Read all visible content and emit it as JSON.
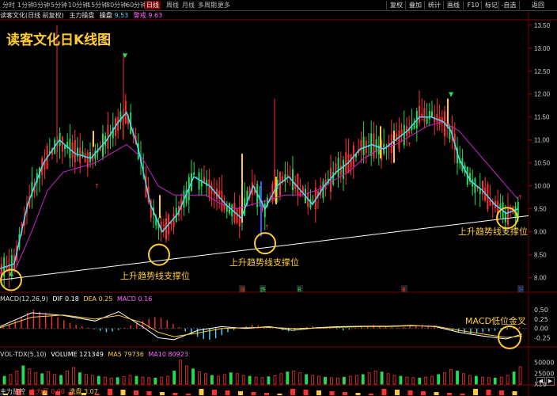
{
  "top_tabs": [
    "分时",
    "1分钟",
    "3分钟",
    "5分钟",
    "10分钟",
    "15分钟",
    "30分钟",
    "60分钟",
    "日线",
    "周线",
    "月线",
    "多周期",
    "更多"
  ],
  "top_tabs_active_index": 8,
  "right_tabs": [
    "复权",
    "叠加",
    "统计",
    "画线",
    "F10",
    "标记",
    "-自选",
    "返回"
  ],
  "info": {
    "stock": "读客文化(日线 前复权)",
    "indicator": "主力操盘",
    "label1": "操盘",
    "value1": "9.53",
    "label2": "警戒",
    "value2": "9.63"
  },
  "panel_title": "读客文化日K线图",
  "annotations": {
    "a1": "上升趋势线支撑位",
    "a2": "上升趋势线支撑位",
    "a3": "上升趋势线支撑位",
    "a4": "MACD低位金叉"
  },
  "price_axis": [
    "13.50",
    "13.00",
    "12.50",
    "12.00",
    "11.50",
    "11.00",
    "10.50",
    "10.00",
    "9.50",
    "9.00",
    "8.50",
    "8.00"
  ],
  "macd_axis": [
    "0.50",
    "0.25",
    "0.00",
    "-0.25"
  ],
  "vol_axis": [
    "50000",
    "25000",
    "X10"
  ],
  "macd_line": {
    "name": "MACD(12,26,9)",
    "dif_label": "DIF",
    "dif": "0.18",
    "dea_label": "DEA",
    "dea": "0.25",
    "macd_label": "MACD",
    "macd": "0.16"
  },
  "vol_line": {
    "name": "VOL-TDX(5,10)",
    "volume_label": "VOLUME",
    "volume": "121349",
    "ma5_label": "MA5",
    "ma5": "79736",
    "ma10_label": "MA10",
    "ma10": "80923"
  },
  "bottom_line": {
    "name": "主力监控",
    "l1": "主力买",
    "v1": "0.00",
    "l2": "洗盘",
    "v2": "3.07"
  },
  "markers": [
    "涨",
    "跌",
    "B",
    "B",
    "好"
  ],
  "colors": {
    "up": "#ff3030",
    "down": "#22dd55",
    "ma_fast": "#4fd8ff",
    "ma_slow": "#d020d0",
    "accent": "#ffcc33",
    "trend": "#ffffff"
  },
  "icons": [
    "up-arrow-icon",
    "down-arrow-icon",
    "scroll-left-icon",
    "scroll-right-icon"
  ],
  "chart_data": {
    "type": "line",
    "title": "读客文化日K线图",
    "ylim": [
      7.7,
      13.6
    ],
    "series": [
      {
        "name": "MA-fast",
        "x": [
          0,
          18,
          35,
          55,
          75,
          95,
          115,
          135,
          150,
          160,
          175,
          190,
          205,
          225,
          245,
          265,
          285,
          305,
          320,
          335,
          350,
          365,
          380,
          395,
          410,
          425,
          440,
          455,
          470,
          485,
          500,
          515,
          530,
          545,
          560,
          570,
          580,
          595,
          610,
          625,
          640,
          655
        ],
        "y": [
          8.2,
          8.3,
          9.6,
          10.5,
          11.0,
          10.7,
          10.6,
          11.0,
          11.4,
          11.6,
          10.8,
          9.6,
          9.0,
          9.4,
          10.2,
          10.0,
          9.6,
          9.3,
          10.0,
          9.5,
          10.0,
          10.2,
          9.9,
          9.6,
          10.0,
          10.3,
          10.5,
          10.8,
          10.9,
          10.8,
          11.0,
          11.2,
          11.5,
          11.5,
          11.4,
          11.2,
          10.6,
          10.1,
          9.9,
          9.6,
          9.4,
          9.5
        ]
      },
      {
        "name": "MA-slow",
        "x": [
          0,
          20,
          40,
          60,
          80,
          100,
          120,
          140,
          160,
          180,
          200,
          220,
          240,
          260,
          280,
          300,
          320,
          340,
          360,
          380,
          400,
          420,
          440,
          460,
          480,
          500,
          520,
          540,
          560,
          580,
          600,
          620,
          640,
          655
        ],
        "y": [
          8.1,
          8.2,
          9.0,
          9.9,
          10.3,
          10.4,
          10.5,
          10.7,
          10.9,
          10.6,
          10.0,
          9.8,
          9.8,
          9.8,
          9.6,
          9.5,
          9.6,
          9.7,
          9.8,
          9.8,
          9.9,
          10.1,
          10.3,
          10.6,
          10.8,
          10.9,
          11.1,
          11.3,
          11.4,
          11.2,
          10.8,
          10.4,
          10.0,
          9.7
        ]
      }
    ],
    "trend_line": {
      "x": [
        0,
        668
      ],
      "y": [
        7.95,
        9.35
      ]
    },
    "support_points": [
      {
        "x": 14,
        "y": 7.95
      },
      {
        "x": 201,
        "y": 8.5
      },
      {
        "x": 335,
        "y": 8.75
      },
      {
        "x": 641,
        "y": 9.3
      }
    ],
    "macd_ylim": [
      -0.45,
      0.65
    ],
    "macd_hist": [
      0.05,
      0.1,
      0.2,
      0.32,
      0.42,
      0.5,
      0.45,
      0.42,
      0.35,
      0.3,
      0.22,
      0.15,
      0.1,
      0.06,
      0.02,
      -0.02,
      -0.06,
      -0.1,
      -0.08,
      -0.04,
      0.02,
      0.08,
      0.14,
      0.2,
      0.26,
      0.3,
      0.28,
      0.22,
      0.12,
      0.04,
      -0.08,
      -0.16,
      -0.22,
      -0.28,
      -0.3,
      -0.26,
      -0.18,
      -0.1,
      -0.04,
      0.02,
      0.06,
      0.1,
      0.08,
      0.05,
      0.02,
      0.0,
      -0.04,
      -0.08,
      -0.05,
      -0.02,
      0.04,
      0.06,
      0.04,
      0.02,
      0.03,
      -0.02,
      -0.05,
      -0.03,
      0.02,
      0.05,
      0.07,
      0.09,
      0.07,
      0.05,
      0.03,
      0.02,
      0.04,
      0.06,
      0.08,
      0.1,
      0.08,
      0.06,
      0.03,
      -0.02,
      -0.06,
      -0.1,
      -0.12,
      -0.14,
      -0.12,
      -0.1,
      -0.08,
      -0.06,
      -0.05,
      -0.03,
      0.02,
      0.04
    ],
    "macd_dif": {
      "x": [
        0,
        40,
        80,
        120,
        150,
        180,
        200,
        220,
        250,
        280,
        310,
        340,
        370,
        400,
        430,
        460,
        490,
        520,
        550,
        580,
        610,
        640,
        660
      ],
      "y": [
        0.05,
        0.42,
        0.35,
        0.2,
        0.45,
        0.05,
        -0.25,
        -0.3,
        -0.05,
        0.05,
        0.0,
        0.05,
        -0.05,
        0.02,
        0.05,
        0.06,
        0.06,
        0.08,
        0.05,
        -0.1,
        -0.2,
        -0.28,
        -0.15
      ]
    },
    "macd_dea": {
      "x": [
        0,
        40,
        80,
        120,
        150,
        180,
        200,
        220,
        250,
        280,
        310,
        340,
        370,
        400,
        430,
        460,
        490,
        520,
        550,
        580,
        610,
        640,
        660
      ],
      "y": [
        0.02,
        0.3,
        0.36,
        0.25,
        0.35,
        0.15,
        -0.1,
        -0.22,
        -0.12,
        0.0,
        0.02,
        0.03,
        0.0,
        0.01,
        0.03,
        0.05,
        0.05,
        0.07,
        0.06,
        -0.05,
        -0.15,
        -0.24,
        -0.2
      ]
    },
    "vol_ylim": [
      0,
      60000
    ],
    "vol_bars": [
      18000,
      22000,
      30000,
      42000,
      35000,
      26000,
      24000,
      28000,
      22000,
      20000,
      30000,
      38000,
      26000,
      22000,
      20000,
      18000,
      16000,
      14000,
      15000,
      17000,
      20000,
      18000,
      16000,
      15000,
      14000,
      16000,
      18000,
      30000,
      55000,
      42000,
      35000,
      28000,
      24000,
      20000,
      18000,
      22000,
      26000,
      24000,
      20000,
      18000,
      16000,
      15000,
      17000,
      19000,
      24000,
      28000,
      30000,
      26000,
      22000,
      20000,
      18000,
      16000,
      15000,
      14000,
      16000,
      18000,
      20000,
      22000,
      26000,
      30000,
      28000,
      24000,
      20000,
      18000,
      16000,
      15000,
      14000,
      16000,
      18000,
      22000,
      26000,
      34000,
      30000,
      24000,
      20000,
      18000,
      16000,
      15000,
      14000,
      16000,
      20000,
      28000,
      40000
    ]
  }
}
